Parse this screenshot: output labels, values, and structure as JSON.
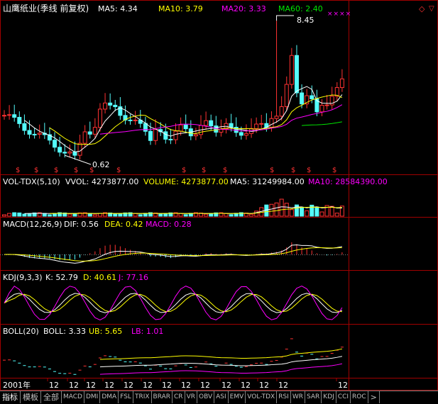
{
  "header": {
    "title": "山鹰纸业(季线 前复权)",
    "ma5": "MA5: 4.34",
    "ma10": "MA10: 3.79",
    "ma20": "MA20: 3.33",
    "ma60": "MA60: 2.40"
  },
  "price": {
    "high_label": "8.45",
    "low_label": "0.62"
  },
  "vol": {
    "name": "VOL-TDX(5,10)",
    "vvol": "VVOL: 4273877.00",
    "volume": "VOLUME: 4273877.00",
    "ma5": "MA5: 31249984.00",
    "ma10": "MA10: 28584390.00"
  },
  "macd": {
    "name": "MACD(12,26,9)",
    "dif": "DIF: 0.56",
    "dea": "DEA: 0.42",
    "macd": "MACD: 0.28"
  },
  "kdj": {
    "name": "KDJ(9,3,3)",
    "k": "K: 52.79",
    "d": "D: 40.61",
    "j": "J: 77.16"
  },
  "boll": {
    "name": "BOLL(20)",
    "boll": "BOLL: 3.33",
    "ub": "UB: 5.65",
    "lb": "LB: 1.01"
  },
  "xaxis": {
    "year": "2001年",
    "ticks": [
      "12",
      "12",
      "12",
      "12",
      "12",
      "12",
      "12",
      "12",
      "12",
      "12",
      "12",
      "12",
      "12",
      "12"
    ]
  },
  "tabs": [
    "指标",
    "模板",
    "全部",
    "MACD",
    "DMI",
    "DMA",
    "FSL",
    "TRIX",
    "BRAR",
    "CR",
    "VR",
    "OBV",
    "ASI",
    "EMV",
    "VOL-TDX",
    "RSI",
    "WR",
    "SAR",
    "KDJ",
    "CCI",
    "ROC"
  ],
  "scroll_label": ">",
  "colors": {
    "up": "#ff3232",
    "down": "#54fcfc",
    "ma5": "#ffffff",
    "ma10": "#ffff00",
    "ma20": "#ff00ff",
    "ma60": "#00e600",
    "grid": "#a00000"
  }
}
